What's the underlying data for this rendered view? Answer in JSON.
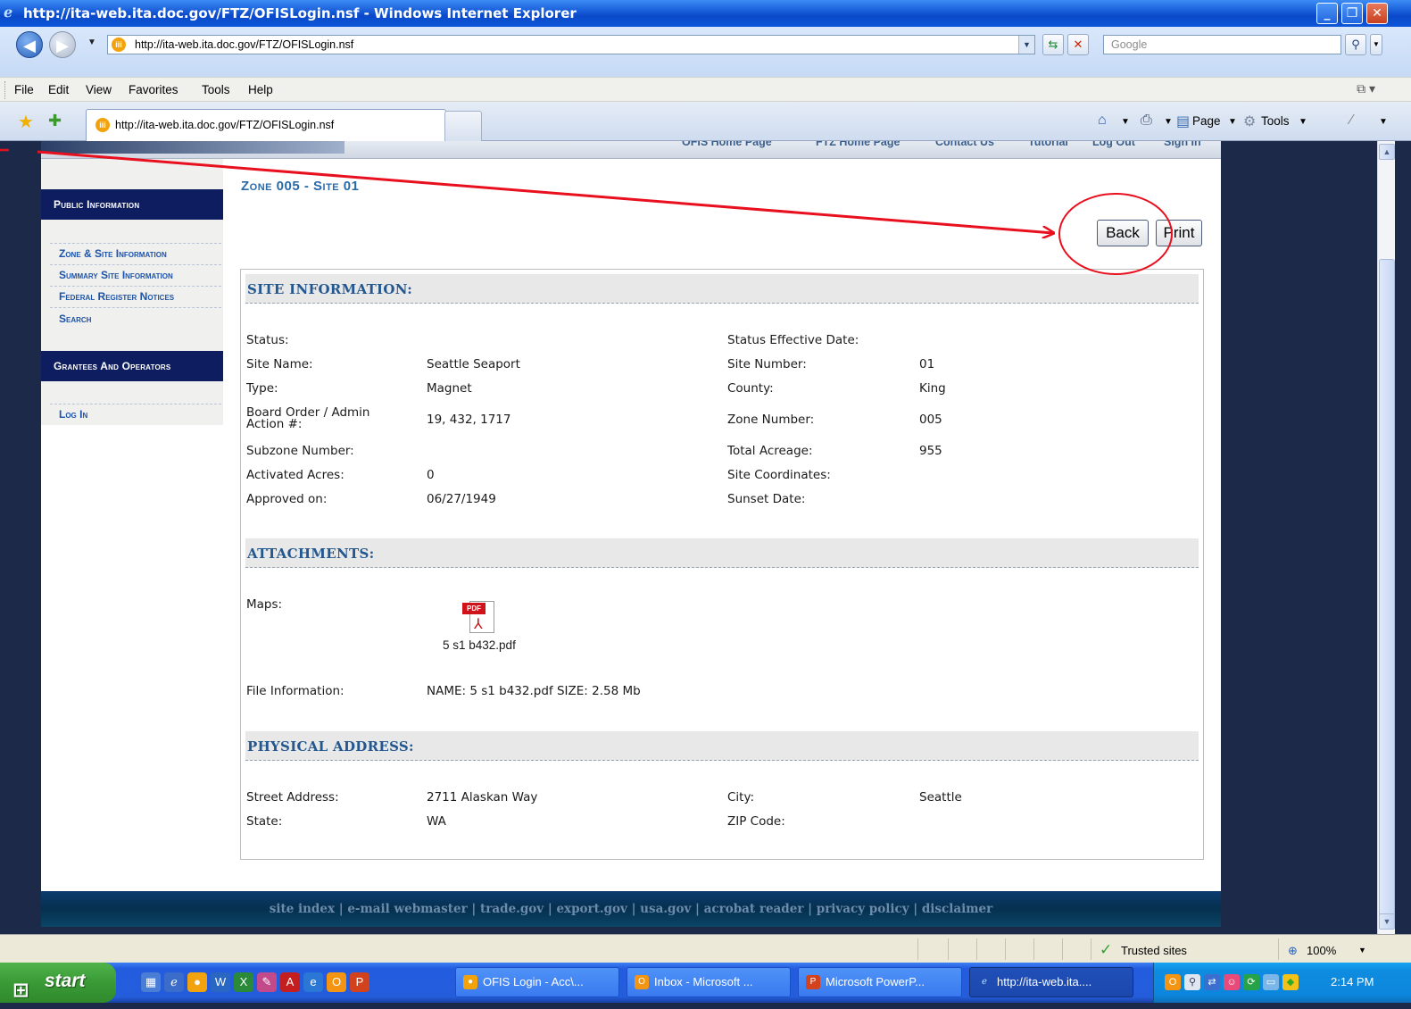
{
  "window": {
    "title": "http://ita-web.ita.doc.gov/FTZ/OFISLogin.nsf - Windows Internet Explorer",
    "minimize_glyph": "_",
    "restore_glyph": "❐",
    "close_glyph": "✕"
  },
  "address_bar": {
    "url": "http://ita-web.ita.doc.gov/FTZ/OFISLogin.nsf",
    "search_placeholder": "Google"
  },
  "menu": {
    "items": [
      "File",
      "Edit",
      "View",
      "Favorites",
      "Tools",
      "Help"
    ]
  },
  "tabs": {
    "active_tab_label": "http://ita-web.ita.doc.gov/FTZ/OFISLogin.nsf"
  },
  "command_bar": {
    "page_label": "Page",
    "tools_label": "Tools"
  },
  "top_nav": {
    "items": [
      "OFIS Home Page",
      "FTZ Home Page",
      "Contact Us",
      "Tutorial",
      "Log Out",
      "Sign In"
    ]
  },
  "sidebar": {
    "public_header": "Public Information",
    "links": [
      "Zone & Site Information",
      "Summary Site Information",
      "Federal Register Notices",
      "Search"
    ],
    "grantees_header": "Grantees And Operators",
    "login_link": "Log In"
  },
  "main": {
    "zone_title": "Zone 005 - Site 01",
    "back_label": "Back",
    "print_label": "Print"
  },
  "site_information": {
    "heading": "SITE INFORMATION:",
    "left": [
      {
        "label": "Status:",
        "value": ""
      },
      {
        "label": "Site Name:",
        "value": "Seattle Seaport"
      },
      {
        "label": "Type:",
        "value": "Magnet"
      },
      {
        "label": "Board Order / Admin Action #:",
        "value": "19, 432, 1717"
      },
      {
        "label": "Subzone Number:",
        "value": ""
      },
      {
        "label": "Activated Acres:",
        "value": "0"
      },
      {
        "label": "Approved on:",
        "value": "06/27/1949"
      }
    ],
    "right": [
      {
        "label": "Status Effective Date:",
        "value": ""
      },
      {
        "label": "Site Number:",
        "value": "01"
      },
      {
        "label": "County:",
        "value": "King"
      },
      {
        "label": "Zone Number:",
        "value": "005"
      },
      {
        "label": "Total Acreage:",
        "value": "955"
      },
      {
        "label": "Site Coordinates:",
        "value": ""
      },
      {
        "label": "Sunset Date:",
        "value": ""
      }
    ]
  },
  "attachments": {
    "heading": "ATTACHMENTS:",
    "maps_label": "Maps:",
    "pdf_badge": "PDF",
    "file_name": "5 s1 b432.pdf",
    "file_info_label": "File Information:",
    "file_info_value": "NAME: 5 s1 b432.pdf SIZE: 2.58 Mb"
  },
  "physical_address": {
    "heading": "PHYSICAL ADDRESS:",
    "street_label": "Street Address:",
    "street_value": "2711 Alaskan Way",
    "city_label": "City:",
    "city_value": "Seattle",
    "state_label": "State:",
    "state_value": "WA",
    "zip_label": "ZIP Code:",
    "zip_value": ""
  },
  "footer": {
    "links_text": "site index | e-mail webmaster | trade.gov | export.gov | usa.gov | acrobat reader | privacy policy | disclaimer"
  },
  "status_bar": {
    "zone": "Trusted sites",
    "zoom": "100%"
  },
  "taskbar": {
    "start_label": "start",
    "tasks": [
      "OFIS Login - Acc\\...",
      "Inbox - Microsoft ...",
      "Microsoft PowerP...",
      "http://ita-web.ita...."
    ],
    "clock": "2:14 PM"
  },
  "colors": {
    "sidebar_header_bg": "#0d1d60",
    "section_title": "#23578f",
    "annotation": "#e8101e",
    "page_frame": "#1c2948"
  }
}
